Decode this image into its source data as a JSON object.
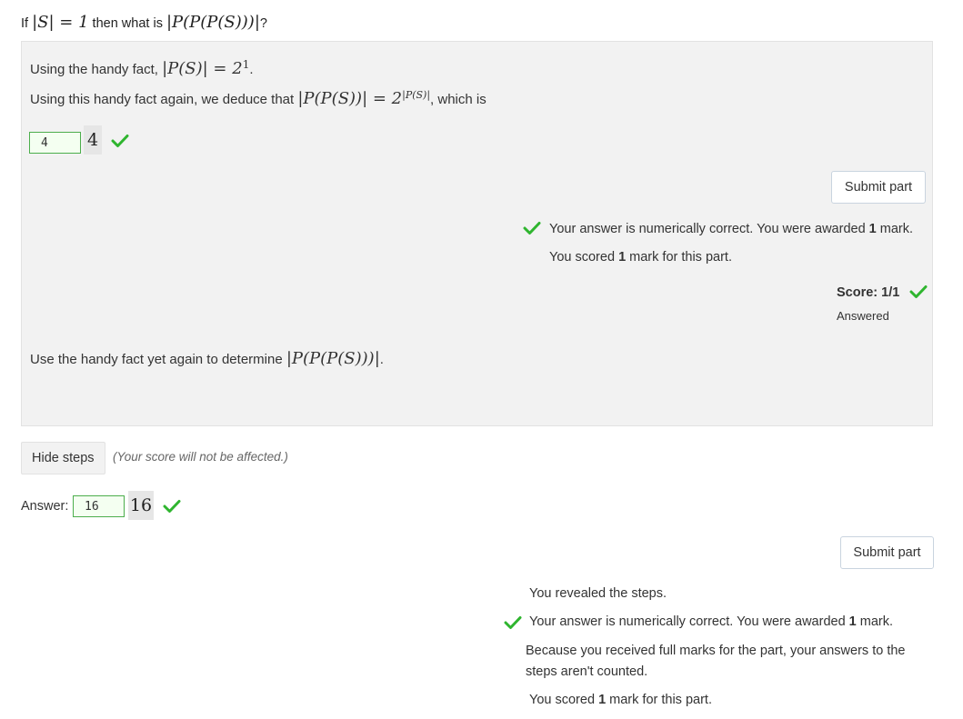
{
  "question": {
    "prefix": "If ",
    "math1": "|S| = 1",
    "middle": " then what is ",
    "math2": "|P(P(P(S)))|",
    "suffix": "?"
  },
  "steps": {
    "step1": {
      "prefix": "Using the handy fact, ",
      "math": "|P(S)| = 2",
      "exp": "1",
      "suffix": "."
    },
    "step2": {
      "prefix": "Using this handy fact again, we deduce that ",
      "math": "|P(P(S))| = 2",
      "exp": "|P(S)|",
      "suffix": ", which is"
    },
    "step2_answer": {
      "value": "4",
      "preview": "4"
    },
    "submit_label": "Submit part",
    "feedback1": {
      "text_a": "Your answer is numerically correct. You were awarded ",
      "bold": "1",
      "text_b": " mark."
    },
    "feedback2": {
      "text_a": "You scored ",
      "bold": "1",
      "text_b": " mark for this part."
    },
    "score_label": "Score: 1/1",
    "status": "Answered",
    "step3": {
      "prefix": "Use the handy fact yet again to determine ",
      "math": "|P(P(P(S)))|",
      "suffix": "."
    }
  },
  "hide_steps": {
    "label": "Hide steps",
    "note": "(Your score will not be affected.)"
  },
  "main_answer": {
    "label": "Answer:",
    "value": "16",
    "preview": "16"
  },
  "main_submit_label": "Submit part",
  "main_feedback": {
    "revealed": "You revealed the steps.",
    "correct": {
      "text_a": "Your answer is numerically correct. You were awarded ",
      "bold": "1",
      "text_b": " mark."
    },
    "full_marks_line1": "Because you received full marks for the part, your answers to the",
    "full_marks_line2": "steps aren't counted.",
    "scored": {
      "text_a": "You scored ",
      "bold": "1",
      "text_b": " mark for this part."
    }
  },
  "colors": {
    "check": "#2fb52f",
    "input_border": "#4cae4c",
    "box_bg": "#f2f2f2"
  },
  "icons": {
    "correct": "check-icon"
  }
}
